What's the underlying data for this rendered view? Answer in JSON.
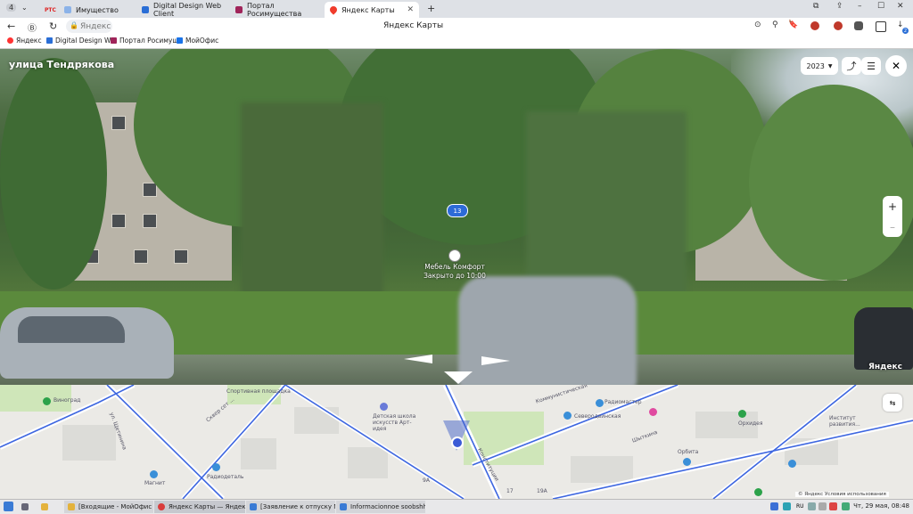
{
  "browser": {
    "tab_counter": "4",
    "tabs": [
      {
        "label": "Имущество",
        "favicon": "ртс-icon"
      },
      {
        "label": "Digital Design Web Client",
        "favicon": "dd-icon"
      },
      {
        "label": "Портал Росимущества",
        "favicon": "portal-icon"
      },
      {
        "label": "Яндекс Карты",
        "favicon": "yandex-maps-icon",
        "active": true
      }
    ],
    "rts_label": "РТС",
    "address_text": "Яндекс",
    "page_title": "Яндекс Карты",
    "extension_badge": "2"
  },
  "bookmarks": [
    {
      "label": "Яндекс"
    },
    {
      "label": "Digital Design We"
    },
    {
      "label": "Портал Росимущ"
    },
    {
      "label": "МойОфис"
    }
  ],
  "panorama": {
    "street_name": "улица Тендрякова",
    "year": "2023",
    "house_number": "13",
    "poi_name": "Мебель Комфорт",
    "poi_status": "Закрыто до 10:00",
    "brand": "Яндекс"
  },
  "map": {
    "labels": [
      "Виноград",
      "ул. Щетинина",
      "Сквер сет ...",
      "Детская школа искусств Арт-идея",
      "Радиомастер",
      "Северодвинская",
      "Шыткина",
      "Орхидея",
      "Институт развития...",
      "Магнит",
      "Радиодеталь",
      "Орбита",
      "17",
      "19А",
      "9А",
      "Спортивная площадка",
      "Коммунистическая",
      "Конституции"
    ],
    "copyright": "© Яндекс   Условия использования"
  },
  "taskbar": {
    "items": [
      {
        "label": "[Входящие - МойОфис П..."
      },
      {
        "label": "Яндекс Карты — Яндекс ..."
      },
      {
        "label": "[Заявление к отпуску МП..."
      },
      {
        "label": "Informacionnoe soobshhe..."
      }
    ],
    "lang": "RU",
    "clock": "Чт, 29 мая, 08:48"
  }
}
